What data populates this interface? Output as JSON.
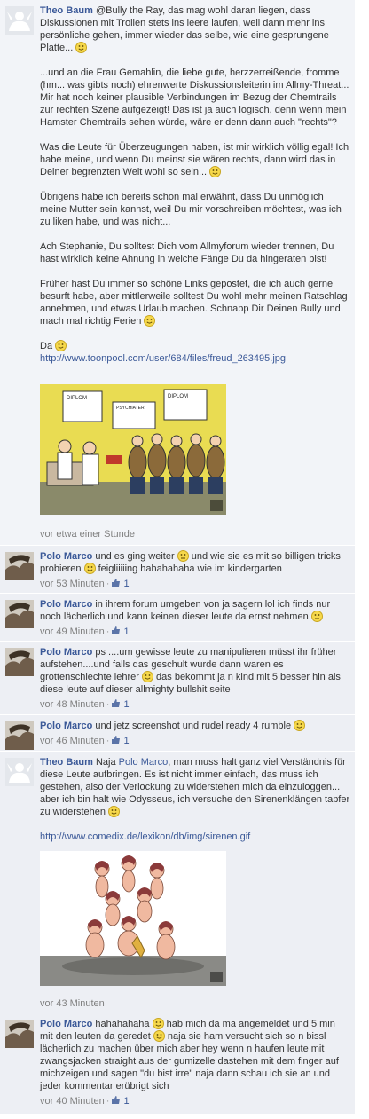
{
  "comments": [
    {
      "author": "Theo Baum",
      "paragraphs": [
        "@Bully the Ray, das mag wohl daran liegen, dass Diskussionen mit Trollen stets ins leere laufen, weil dann mehr ins persönliche gehen, immer wieder das selbe, wie eine gesprungene Platte...",
        "...und an die Frau Gemahlin, die liebe gute, herzzerreißende, fromme (hm... was gibts noch) ehrenwerte Diskussionsleiterin im Allmy-Threat... Mir hat noch keiner plausible Verbindungen im Bezug der Chemtrails zur rechten Szene aufgezeigt! Das ist ja auch logisch, denn wenn mein Hamster Chemtrails sehen würde, wäre er denn dann auch \"rechts\"?",
        "Was die Leute für Überzeugungen haben, ist mir wirklich völlig egal! Ich habe meine, und wenn Du meinst sie wären rechts, dann wird das in Deiner begrenzten Welt wohl so sein...",
        "Übrigens habe ich bereits schon mal erwähnt, dass Du unmöglich meine Mutter sein kannst, weil Du mir vorschreiben möchtest, was ich zu liken habe, und was nicht...",
        "Ach Stephanie, Du solltest Dich vom Allmyforum wieder trennen, Du hast wirklich keine Ahnung in welche Fänge Du da hingeraten bist!",
        "Früher hast Du immer so schöne Links gepostet, die ich auch gerne besurft habe, aber mittlerweile solltest Du wohl mehr meinen Ratschlag annehmen, und etwas Urlaub machen. Schnapp Dir Deinen Bully und mach mal richtig Ferien",
        "Da"
      ],
      "link": "http://www.toonpool.com/user/684/files/freud_263495.jpg",
      "time": "vor etwa einer Stunde"
    },
    {
      "author": "Polo Marco",
      "text_a": "und es ging weiter",
      "text_b": "und wie sie es mit so billigen tricks probieren",
      "text_c": "feigliiiiing hahahahaha wie im kindergarten",
      "time": "vor 53 Minuten",
      "likes": "1"
    },
    {
      "author": "Polo Marco",
      "text_a": "in ihrem forum umgeben von ja sagern lol ich finds nur noch lächerlich und kann keinen dieser leute da ernst nehmen",
      "time": "vor 49 Minuten",
      "likes": "1"
    },
    {
      "author": "Polo Marco",
      "text_a": "ps ....um gewisse leute zu manipulieren müsst ihr früher aufstehen....und falls das geschult wurde dann waren es grottenschlechte lehrer",
      "text_b": "das bekommt ja n kind mit 5 besser hin als diese leute auf dieser allmighty bullshit seite",
      "time": "vor 48 Minuten",
      "likes": "1"
    },
    {
      "author": "Polo Marco",
      "text_a": "und jetz screenshot und rudel ready 4 rumble",
      "time": "vor 46 Minuten",
      "likes": "1"
    },
    {
      "author": "Theo Baum",
      "text_a": "Naja",
      "mention": "Polo Marco",
      "text_b": ", man muss halt ganz viel Verständnis für diese Leute aufbringen. Es ist nicht immer einfach, das muss ich gestehen, also der Verlockung zu widerstehen mich da einzuloggen... aber ich bin halt wie Odysseus, ich versuche den Sirenenklängen tapfer zu widerstehen",
      "link": "http://www.comedix.de/lexikon/db/img/sirenen.gif",
      "time": "vor 43 Minuten"
    },
    {
      "author": "Polo Marco",
      "text_a": "hahahahaha",
      "text_b": "hab mich da ma angemeldet und 5 min mit den leuten da geredet",
      "text_c": "naja sie ham versucht sich so n bissl lächerlich zu machen über mich aber hey wenn n haufen leute mit zwangsjacken straight aus der gumizelle dastehen mit dem finger auf michzeigen und sagen \"du bist irre\" naja dann schau ich sie an und jeder kommentar erübrigt sich",
      "time": "vor 40 Minuten",
      "likes": "1"
    }
  ],
  "attachment_1": {
    "diploma_left": "DIPLOM",
    "diploma_mid": "PSYCHIATER",
    "diploma_right": "DIPLOM"
  },
  "colors": {
    "link": "#3b5998",
    "comment_bg": "#edeff4",
    "meta": "#808080"
  }
}
